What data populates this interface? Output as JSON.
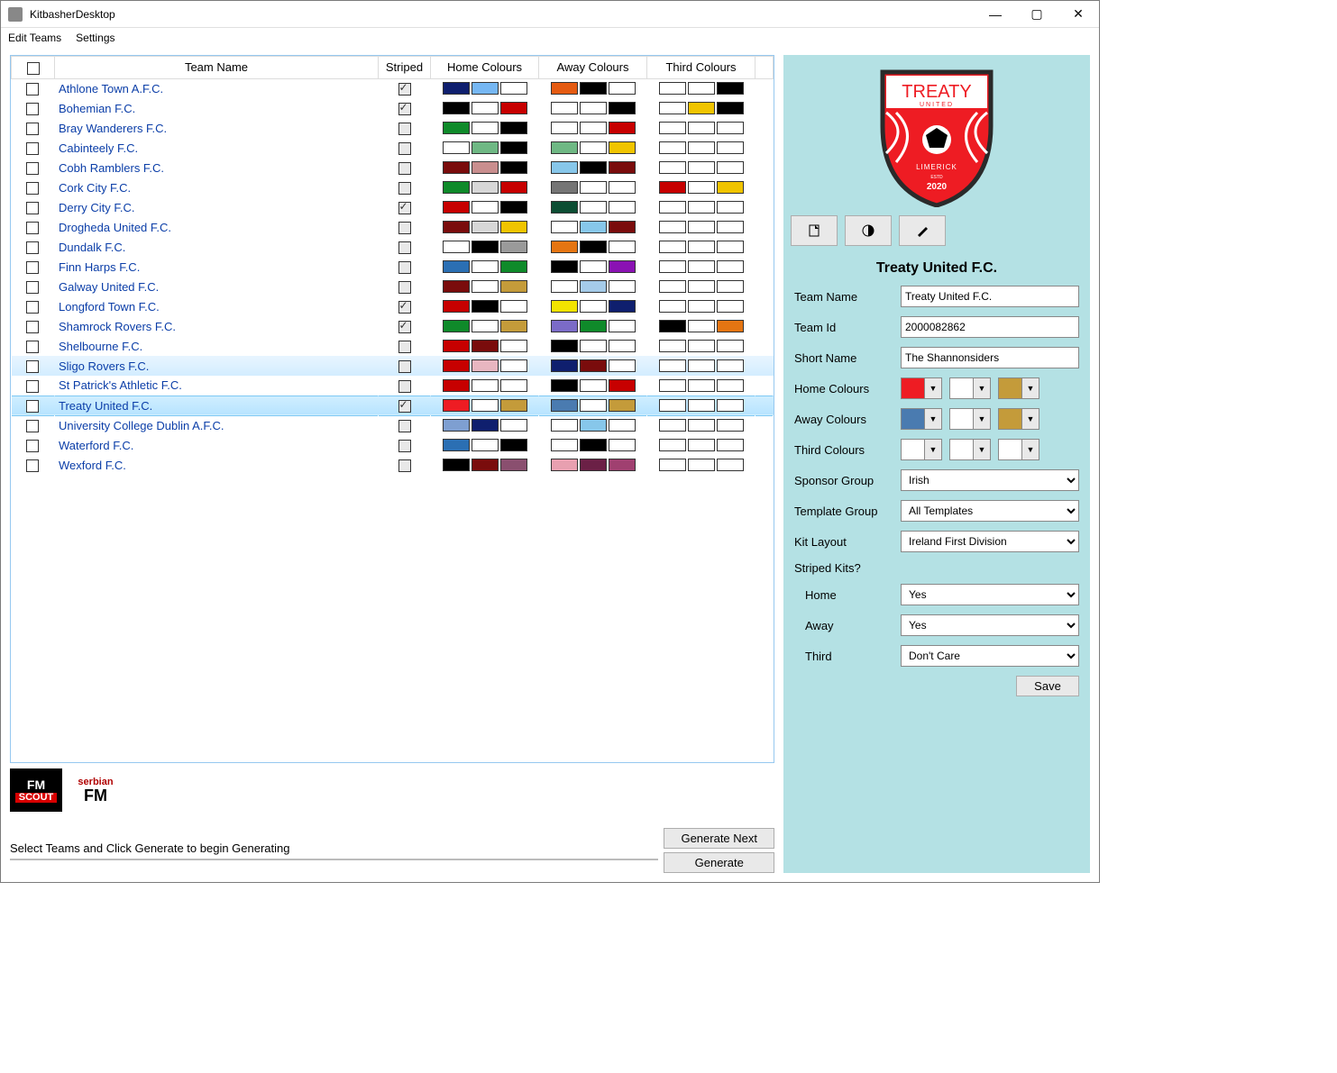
{
  "window": {
    "title": "KitbasherDesktop"
  },
  "menu": [
    "Edit Teams",
    "Settings"
  ],
  "columns": [
    "",
    "Team Name",
    "Striped",
    "Home Colours",
    "Away Colours",
    "Third Colours",
    ""
  ],
  "teams": [
    {
      "name": "Athlone Town A.F.C.",
      "striped": true,
      "home": [
        "#0f1f6e",
        "#76b7f3",
        "#ffffff"
      ],
      "away": [
        "#e55b12",
        "#000000",
        "#ffffff"
      ],
      "third": [
        "#ffffff",
        "#ffffff",
        "#000000"
      ]
    },
    {
      "name": "Bohemian F.C.",
      "striped": true,
      "home": [
        "#000000",
        "#ffffff",
        "#c70000"
      ],
      "away": [
        "#ffffff",
        "#ffffff",
        "#000000"
      ],
      "third": [
        "#ffffff",
        "#f0c400",
        "#000000"
      ]
    },
    {
      "name": "Bray Wanderers F.C.",
      "striped": false,
      "home": [
        "#0f8a2a",
        "#ffffff",
        "#000000"
      ],
      "away": [
        "#ffffff",
        "#ffffff",
        "#c70000"
      ],
      "third": [
        "#ffffff",
        "#ffffff",
        "#ffffff"
      ]
    },
    {
      "name": "Cabinteely F.C.",
      "striped": false,
      "home": [
        "#ffffff",
        "#6fb884",
        "#000000"
      ],
      "away": [
        "#6fb884",
        "#ffffff",
        "#f0c400"
      ],
      "third": [
        "#ffffff",
        "#ffffff",
        "#ffffff"
      ]
    },
    {
      "name": "Cobh Ramblers F.C.",
      "striped": false,
      "home": [
        "#7a0c0c",
        "#c98e8e",
        "#000000"
      ],
      "away": [
        "#87c7ea",
        "#000000",
        "#7a0c0c"
      ],
      "third": [
        "#ffffff",
        "#ffffff",
        "#ffffff"
      ]
    },
    {
      "name": "Cork City F.C.",
      "striped": false,
      "home": [
        "#0f8a2a",
        "#d7d7d7",
        "#c70000"
      ],
      "away": [
        "#757575",
        "#ffffff",
        "#ffffff"
      ],
      "third": [
        "#c70000",
        "#ffffff",
        "#f0c400"
      ]
    },
    {
      "name": "Derry City F.C.",
      "striped": true,
      "home": [
        "#c70000",
        "#ffffff",
        "#000000"
      ],
      "away": [
        "#0c4d33",
        "#ffffff",
        "#ffffff"
      ],
      "third": [
        "#ffffff",
        "#ffffff",
        "#ffffff"
      ]
    },
    {
      "name": "Drogheda United F.C.",
      "striped": false,
      "home": [
        "#7a0c0c",
        "#d7d7d7",
        "#f0c400"
      ],
      "away": [
        "#ffffff",
        "#87c7ea",
        "#7a0c0c"
      ],
      "third": [
        "#ffffff",
        "#ffffff",
        "#ffffff"
      ]
    },
    {
      "name": "Dundalk F.C.",
      "striped": false,
      "home": [
        "#ffffff",
        "#000000",
        "#9a9a9a"
      ],
      "away": [
        "#e57512",
        "#000000",
        "#ffffff"
      ],
      "third": [
        "#ffffff",
        "#ffffff",
        "#ffffff"
      ]
    },
    {
      "name": "Finn Harps F.C.",
      "striped": false,
      "home": [
        "#2b6fb3",
        "#ffffff",
        "#0f8a2a"
      ],
      "away": [
        "#000000",
        "#ffffff",
        "#8a12b3"
      ],
      "third": [
        "#ffffff",
        "#ffffff",
        "#ffffff"
      ]
    },
    {
      "name": "Galway United F.C.",
      "striped": false,
      "home": [
        "#7a0c0c",
        "#ffffff",
        "#c49b3a"
      ],
      "away": [
        "#ffffff",
        "#a5cbe9",
        "#ffffff"
      ],
      "third": [
        "#ffffff",
        "#ffffff",
        "#ffffff"
      ]
    },
    {
      "name": "Longford Town F.C.",
      "striped": true,
      "home": [
        "#c70000",
        "#000000",
        "#ffffff"
      ],
      "away": [
        "#f2e400",
        "#ffffff",
        "#0f1f6e"
      ],
      "third": [
        "#ffffff",
        "#ffffff",
        "#ffffff"
      ]
    },
    {
      "name": "Shamrock Rovers F.C.",
      "striped": true,
      "home": [
        "#0f8a2a",
        "#ffffff",
        "#c49b3a"
      ],
      "away": [
        "#7b6bc7",
        "#0f8a2a",
        "#ffffff"
      ],
      "third": [
        "#000000",
        "#ffffff",
        "#e57512"
      ]
    },
    {
      "name": "Shelbourne F.C.",
      "striped": false,
      "home": [
        "#c70000",
        "#7a0c0c",
        "#ffffff"
      ],
      "away": [
        "#000000",
        "#ffffff",
        "#ffffff"
      ],
      "third": [
        "#ffffff",
        "#ffffff",
        "#ffffff"
      ]
    },
    {
      "name": "Sligo Rovers F.C.",
      "striped": false,
      "sel": 1,
      "home": [
        "#c70000",
        "#e8b6c0",
        "#ffffff"
      ],
      "away": [
        "#0f1f6e",
        "#7a0c0c",
        "#ffffff"
      ],
      "third": [
        "#ffffff",
        "#ffffff",
        "#ffffff"
      ]
    },
    {
      "name": "St Patrick's Athletic F.C.",
      "striped": false,
      "home": [
        "#c70000",
        "#ffffff",
        "#ffffff"
      ],
      "away": [
        "#000000",
        "#ffffff",
        "#c70000"
      ],
      "third": [
        "#ffffff",
        "#ffffff",
        "#ffffff"
      ]
    },
    {
      "name": "Treaty United F.C.",
      "striped": true,
      "sel": 2,
      "home": [
        "#ee1c23",
        "#ffffff",
        "#c49b3a"
      ],
      "away": [
        "#4a7bb0",
        "#ffffff",
        "#c49b3a"
      ],
      "third": [
        "#ffffff",
        "#ffffff",
        "#ffffff"
      ]
    },
    {
      "name": "University College Dublin A.F.C.",
      "striped": false,
      "home": [
        "#7e9fd1",
        "#0f1f6e",
        "#ffffff"
      ],
      "away": [
        "#ffffff",
        "#87c7ea",
        "#ffffff"
      ],
      "third": [
        "#ffffff",
        "#ffffff",
        "#ffffff"
      ]
    },
    {
      "name": "Waterford F.C.",
      "striped": false,
      "home": [
        "#2b6fb3",
        "#ffffff",
        "#000000"
      ],
      "away": [
        "#ffffff",
        "#000000",
        "#ffffff"
      ],
      "third": [
        "#ffffff",
        "#ffffff",
        "#ffffff"
      ]
    },
    {
      "name": "Wexford F.C.",
      "striped": false,
      "home": [
        "#000000",
        "#7a0c0c",
        "#8a4f6f"
      ],
      "away": [
        "#e8a0b0",
        "#6b2046",
        "#a04070"
      ],
      "third": [
        "#ffffff",
        "#ffffff",
        "#ffffff"
      ]
    }
  ],
  "hint": "Select Teams and Click Generate to begin Generating",
  "buttons": {
    "generate_next": "Generate Next",
    "generate": "Generate",
    "save": "Save"
  },
  "panel": {
    "title": "Treaty United F.C.",
    "labels": {
      "team_name": "Team Name",
      "team_id": "Team Id",
      "short_name": "Short Name",
      "home": "Home Colours",
      "away": "Away Colours",
      "third": "Third Colours",
      "sponsor": "Sponsor Group",
      "template": "Template Group",
      "kit": "Kit Layout",
      "striped": "Striped Kits?",
      "sh": "Home",
      "sa": "Away",
      "st": "Third"
    },
    "values": {
      "team_name": "Treaty United F.C.",
      "team_id": "2000082862",
      "short_name": "The Shannonsiders",
      "sponsor": "Irish",
      "template": "All Templates",
      "kit": "Ireland First Division",
      "sh": "Yes",
      "sa": "Yes",
      "st": "Don't Care"
    },
    "home_colours": [
      "#ee1c23",
      "#ffffff",
      "#c49b3a"
    ],
    "away_colours": [
      "#4a7bb0",
      "#ffffff",
      "#c49b3a"
    ],
    "third_colours": [
      "#ffffff",
      "#ffffff",
      "#ffffff"
    ]
  },
  "crest": {
    "top": "TREATY",
    "sub": "UNITED",
    "city": "LIMERICK",
    "estd": "ESTD",
    "year": "2020"
  }
}
